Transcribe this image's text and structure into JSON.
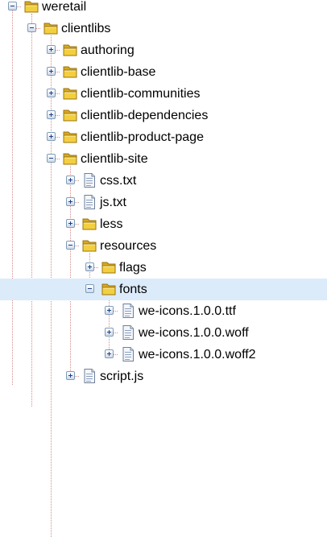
{
  "tree": {
    "rows": [
      {
        "label": "weretail",
        "state": "expanded",
        "icon": "folder-icon",
        "level": 0,
        "selected": false
      },
      {
        "label": "clientlibs",
        "state": "expanded",
        "icon": "folder-icon",
        "level": 1,
        "selected": false
      },
      {
        "label": "authoring",
        "state": "collapsed",
        "icon": "folder-icon",
        "level": 2,
        "selected": false
      },
      {
        "label": "clientlib-base",
        "state": "collapsed",
        "icon": "folder-icon",
        "level": 2,
        "selected": false
      },
      {
        "label": "clientlib-communities",
        "state": "collapsed",
        "icon": "folder-icon",
        "level": 2,
        "selected": false
      },
      {
        "label": "clientlib-dependencies",
        "state": "collapsed",
        "icon": "folder-icon",
        "level": 2,
        "selected": false
      },
      {
        "label": "clientlib-product-page",
        "state": "collapsed",
        "icon": "folder-icon",
        "level": 2,
        "selected": false
      },
      {
        "label": "clientlib-site",
        "state": "expanded",
        "icon": "folder-icon",
        "level": 2,
        "selected": false
      },
      {
        "label": "css.txt",
        "state": "collapsed",
        "icon": "file-icon",
        "level": 3,
        "selected": false
      },
      {
        "label": "js.txt",
        "state": "collapsed",
        "icon": "file-icon",
        "level": 3,
        "selected": false
      },
      {
        "label": "less",
        "state": "collapsed",
        "icon": "folder-icon",
        "level": 3,
        "selected": false
      },
      {
        "label": "resources",
        "state": "expanded",
        "icon": "folder-icon",
        "level": 3,
        "selected": false
      },
      {
        "label": "flags",
        "state": "collapsed",
        "icon": "folder-icon",
        "level": 4,
        "selected": false
      },
      {
        "label": "fonts",
        "state": "expanded",
        "icon": "folder-icon",
        "level": 4,
        "selected": true
      },
      {
        "label": "we-icons.1.0.0.ttf",
        "state": "collapsed",
        "icon": "file-icon",
        "level": 5,
        "selected": false
      },
      {
        "label": "we-icons.1.0.0.woff",
        "state": "collapsed",
        "icon": "file-icon",
        "level": 5,
        "selected": false
      },
      {
        "label": "we-icons.1.0.0.woff2",
        "state": "collapsed",
        "icon": "file-icon",
        "level": 5,
        "selected": false
      },
      {
        "label": "script.js",
        "state": "collapsed",
        "icon": "file-icon",
        "level": 3,
        "selected": false
      }
    ]
  },
  "colors": {
    "selection": "#dcebfa",
    "connector": "#d98b8b",
    "folder": "#f3cf3f",
    "toggle_border": "#7f9db9"
  }
}
